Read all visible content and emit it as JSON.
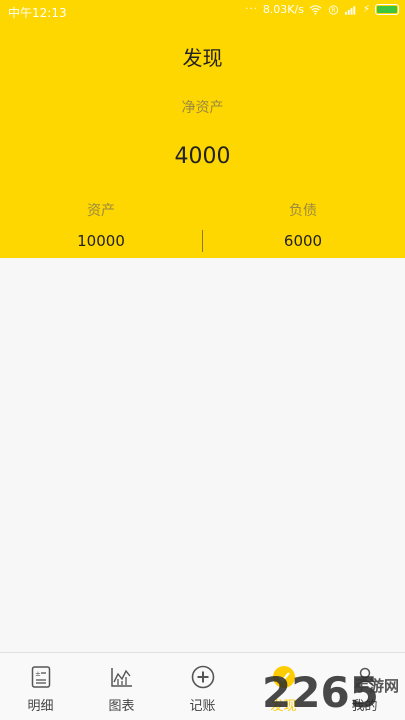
{
  "status_bar": {
    "time": "中午12:13",
    "indicators": "···",
    "speed": "8.03K/s"
  },
  "header": {
    "title": "发现",
    "net_assets_label": "净资产",
    "net_assets_value": "4000",
    "assets_label": "资产",
    "assets_value": "10000",
    "liabilities_label": "负债",
    "liabilities_value": "6000",
    "background_color": "#ffd700"
  },
  "tabs": [
    {
      "label": "明细",
      "icon": "document-icon",
      "active": false
    },
    {
      "label": "图表",
      "icon": "chart-icon",
      "active": false
    },
    {
      "label": "记账",
      "icon": "add-circle-icon",
      "active": false
    },
    {
      "label": "发现",
      "icon": "discover-icon",
      "active": true
    },
    {
      "label": "我的",
      "icon": "profile-icon",
      "active": false
    }
  ],
  "watermark": {
    "digits": "2265",
    "site": "手游网"
  }
}
